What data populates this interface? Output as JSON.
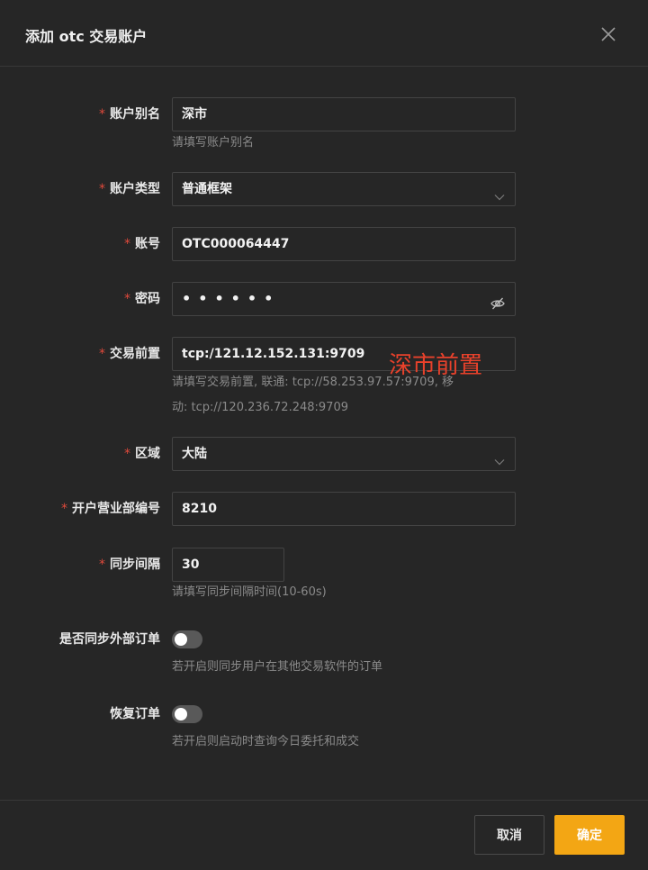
{
  "dialog": {
    "title": "添加 otc 交易账户"
  },
  "icons": {
    "close": "close-icon",
    "select_arrow": "chevron-down-icon",
    "password_toggle": "eye-off-icon"
  },
  "colors": {
    "required_star": "#e04a3c",
    "primary_button": "#f3a614",
    "annotation": "#e8412b"
  },
  "form": {
    "account_alias": {
      "required": "*",
      "label": "账户别名",
      "value": "深市",
      "help": "请填写账户别名"
    },
    "account_type": {
      "required": "*",
      "label": "账户类型",
      "value": "普通框架"
    },
    "account_no": {
      "required": "*",
      "label": "账号",
      "value": "OTC000064447"
    },
    "password": {
      "required": "*",
      "label": "密码",
      "value": "••••••"
    },
    "front_address": {
      "required": "*",
      "label": "交易前置",
      "value": "tcp:/121.12.152.131:9709",
      "help_line1": "请填写交易前置, 联通: tcp://58.253.97.57:9709, 移",
      "help_line2": "动: tcp://120.236.72.248:9709"
    },
    "region": {
      "required": "*",
      "label": "区域",
      "value": "大陆"
    },
    "branch_no": {
      "required": "*",
      "label": "开户营业部编号",
      "value": "8210"
    },
    "sync_interval": {
      "required": "*",
      "label": "同步间隔",
      "value": "30",
      "help": "请填写同步间隔时间(10-60s)"
    },
    "sync_external_orders": {
      "label": "是否同步外部订单",
      "enabled": false,
      "help": "若开启则同步用户在其他交易软件的订单"
    },
    "restore_orders": {
      "label": "恢复订单",
      "enabled": false,
      "help": "若开启则启动时查询今日委托和成交"
    }
  },
  "annotation": {
    "text": "深市前置"
  },
  "footer": {
    "cancel_label": "取消",
    "ok_label": "确定"
  }
}
